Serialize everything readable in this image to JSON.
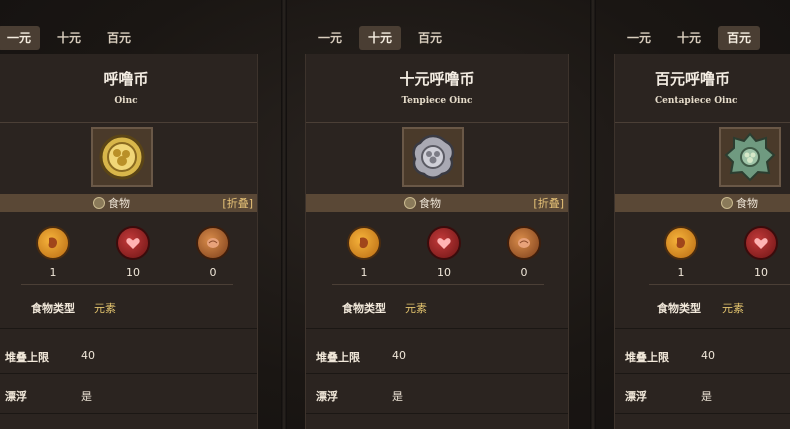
{
  "columns": [
    {
      "tabs": [
        "一元",
        "十元",
        "百元"
      ],
      "active_tab": 0,
      "title": "呼噜币",
      "subtitle": "Oinc",
      "coin_color": "#d8b64a",
      "category": "食物",
      "fold": "[折叠]",
      "stats": {
        "hunger": "1",
        "health": "10",
        "sanity": "0"
      },
      "food_type_label": "食物类型",
      "food_type_value": "元素",
      "stack_label": "堆叠上限",
      "stack_value": "40",
      "float_label": "漂浮",
      "float_value": "是"
    },
    {
      "tabs": [
        "一元",
        "十元",
        "百元"
      ],
      "active_tab": 1,
      "title": "十元呼噜币",
      "subtitle": "Tenpiece Oinc",
      "coin_color": "#a9a9b3",
      "category": "食物",
      "fold": "[折叠]",
      "stats": {
        "hunger": "1",
        "health": "10",
        "sanity": "0"
      },
      "food_type_label": "食物类型",
      "food_type_value": "元素",
      "stack_label": "堆叠上限",
      "stack_value": "40",
      "float_label": "漂浮",
      "float_value": "是"
    },
    {
      "tabs": [
        "一元",
        "十元",
        "百元"
      ],
      "active_tab": 2,
      "title": "百元呼噜币",
      "subtitle": "Centapiece Oinc",
      "coin_color": "#6f9a80",
      "category": "食物",
      "stats": {
        "hunger": "1",
        "health": "10"
      },
      "food_type_label": "食物类型",
      "food_type_value": "元素",
      "stack_label": "堆叠上限",
      "stack_value": "40",
      "float_label": "漂浮",
      "float_value": "是"
    }
  ],
  "icons": {
    "hunger": "stomach-icon",
    "health": "heart-icon",
    "sanity": "brain-icon",
    "category": "leaf-icon"
  }
}
